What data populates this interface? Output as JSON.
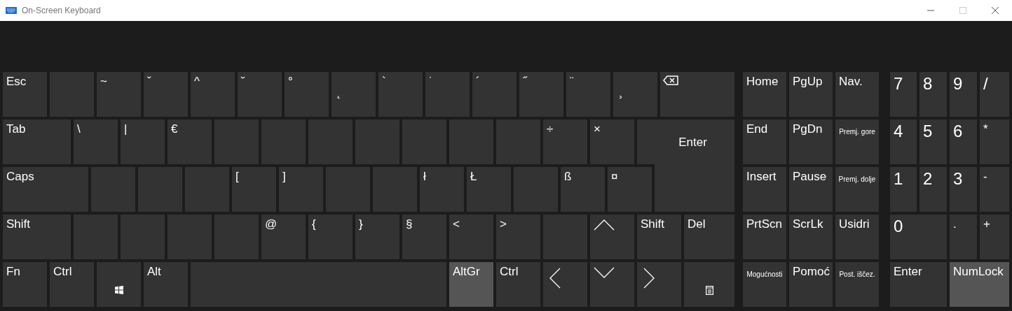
{
  "window": {
    "title": "On-Screen Keyboard"
  },
  "main_rows": [
    [
      {
        "label": "Esc",
        "kind": "text",
        "on": false
      },
      {
        "kind": "text",
        "on": false
      },
      {
        "label": "~",
        "kind": "text",
        "on": false
      },
      {
        "label": "ˇ",
        "kind": "text",
        "on": false
      },
      {
        "label": "^",
        "kind": "text",
        "on": false
      },
      {
        "label": "˘",
        "kind": "text",
        "on": false
      },
      {
        "label": "°",
        "kind": "text",
        "on": false
      },
      {
        "label": "˛",
        "kind": "low",
        "on": false
      },
      {
        "label": "`",
        "kind": "text",
        "on": false
      },
      {
        "label": "˙",
        "kind": "text",
        "on": false
      },
      {
        "label": "´",
        "kind": "text",
        "on": false
      },
      {
        "label": "˝",
        "kind": "text",
        "on": false
      },
      {
        "label": "¨",
        "kind": "text",
        "on": false
      },
      {
        "label": "¸",
        "kind": "low",
        "on": false
      },
      {
        "kind": "backspace",
        "on": false
      }
    ],
    [
      {
        "label": "Tab",
        "kind": "text",
        "on": false
      },
      {
        "label": "\\",
        "kind": "text",
        "on": false
      },
      {
        "label": "|",
        "kind": "text",
        "on": false
      },
      {
        "label": "€",
        "kind": "text",
        "on": false
      },
      {
        "kind": "text",
        "on": false
      },
      {
        "kind": "text",
        "on": false
      },
      {
        "kind": "text",
        "on": false
      },
      {
        "kind": "text",
        "on": false
      },
      {
        "kind": "text",
        "on": false
      },
      {
        "kind": "text",
        "on": false
      },
      {
        "kind": "text",
        "on": false
      },
      {
        "label": "÷",
        "kind": "text",
        "on": false
      },
      {
        "label": "×",
        "kind": "text",
        "on": false
      },
      {
        "label": "Enter",
        "kind": "center",
        "on": false
      }
    ],
    [
      {
        "label": "Caps",
        "kind": "text",
        "on": false
      },
      {
        "kind": "text",
        "on": false
      },
      {
        "kind": "text",
        "on": false
      },
      {
        "kind": "text",
        "on": false
      },
      {
        "label": "[",
        "kind": "text",
        "on": false
      },
      {
        "label": "]",
        "kind": "text",
        "on": false
      },
      {
        "kind": "text",
        "on": false
      },
      {
        "kind": "text",
        "on": false
      },
      {
        "label": "ł",
        "kind": "text",
        "on": false
      },
      {
        "label": "Ł",
        "kind": "text",
        "on": false
      },
      {
        "kind": "text",
        "on": false
      },
      {
        "label": "ß",
        "kind": "text",
        "on": false
      },
      {
        "label": "¤",
        "kind": "text",
        "on": false
      },
      {
        "kind": "enterlow",
        "on": false
      }
    ],
    [
      {
        "label": "Shift",
        "kind": "text",
        "on": false
      },
      {
        "kind": "text",
        "on": false
      },
      {
        "kind": "text",
        "on": false
      },
      {
        "kind": "text",
        "on": false
      },
      {
        "kind": "text",
        "on": false
      },
      {
        "label": "@",
        "kind": "text",
        "on": false
      },
      {
        "label": "{",
        "kind": "text",
        "on": false
      },
      {
        "label": "}",
        "kind": "text",
        "on": false
      },
      {
        "label": "§",
        "kind": "text",
        "on": false
      },
      {
        "label": "<",
        "kind": "text",
        "on": false
      },
      {
        "label": ">",
        "kind": "text",
        "on": false
      },
      {
        "kind": "text",
        "on": false
      },
      {
        "kind": "up",
        "on": false
      },
      {
        "label": "Shift",
        "kind": "text",
        "on": false
      },
      {
        "label": "Del",
        "kind": "text",
        "on": false
      }
    ],
    [
      {
        "label": "Fn",
        "kind": "text",
        "on": false
      },
      {
        "label": "Ctrl",
        "kind": "text",
        "on": false
      },
      {
        "kind": "windows",
        "on": false
      },
      {
        "label": "Alt",
        "kind": "text",
        "on": false
      },
      {
        "kind": "text",
        "on": false
      },
      {
        "label": "AltGr",
        "kind": "text",
        "on": true
      },
      {
        "label": "Ctrl",
        "kind": "text",
        "on": false
      },
      {
        "kind": "left",
        "on": false
      },
      {
        "kind": "down",
        "on": false
      },
      {
        "kind": "right",
        "on": false
      },
      {
        "kind": "menu",
        "on": false
      }
    ]
  ],
  "nav_rows": [
    [
      {
        "label": "Home",
        "kind": "text",
        "on": false
      },
      {
        "label": "PgUp",
        "kind": "text",
        "on": false
      },
      {
        "label": "Nav.",
        "kind": "text",
        "on": false
      }
    ],
    [
      {
        "label": "End",
        "kind": "text",
        "on": false
      },
      {
        "label": "PgDn",
        "kind": "text",
        "on": false
      },
      {
        "label": "Premj. gore",
        "kind": "small",
        "on": false
      }
    ],
    [
      {
        "label": "Insert",
        "kind": "text",
        "on": false
      },
      {
        "label": "Pause",
        "kind": "text",
        "on": false
      },
      {
        "label": "Premj. dolje",
        "kind": "small",
        "on": false
      }
    ],
    [
      {
        "label": "PrtScn",
        "kind": "text",
        "on": false
      },
      {
        "label": "ScrLk",
        "kind": "text",
        "on": false
      },
      {
        "label": "Usidri",
        "kind": "text",
        "on": false
      }
    ],
    [
      {
        "label": "Mogućnosti",
        "kind": "small",
        "on": false
      },
      {
        "label": "Pomoć",
        "kind": "text",
        "on": false
      },
      {
        "label": "Post. iščez.",
        "kind": "small",
        "on": false
      }
    ]
  ],
  "numpad_rows": [
    [
      {
        "label": "7",
        "kind": "num",
        "on": false
      },
      {
        "label": "8",
        "kind": "num",
        "on": false
      },
      {
        "label": "9",
        "kind": "num",
        "on": false
      },
      {
        "label": "/",
        "kind": "num",
        "on": false
      }
    ],
    [
      {
        "label": "4",
        "kind": "num",
        "on": false
      },
      {
        "label": "5",
        "kind": "num",
        "on": false
      },
      {
        "label": "6",
        "kind": "num",
        "on": false
      },
      {
        "label": "*",
        "kind": "text",
        "on": false
      }
    ],
    [
      {
        "label": "1",
        "kind": "num",
        "on": false
      },
      {
        "label": "2",
        "kind": "num",
        "on": false
      },
      {
        "label": "3",
        "kind": "num",
        "on": false
      },
      {
        "label": "-",
        "kind": "text",
        "on": false
      }
    ],
    [
      {
        "label": "0",
        "kind": "num",
        "on": false
      },
      {
        "label": ".",
        "kind": "text",
        "on": false
      },
      {
        "label": "+",
        "kind": "text",
        "on": false
      }
    ],
    [
      {
        "label": "Enter",
        "kind": "text",
        "on": false
      },
      {
        "label": "NumLock",
        "kind": "text",
        "on": true
      }
    ]
  ]
}
